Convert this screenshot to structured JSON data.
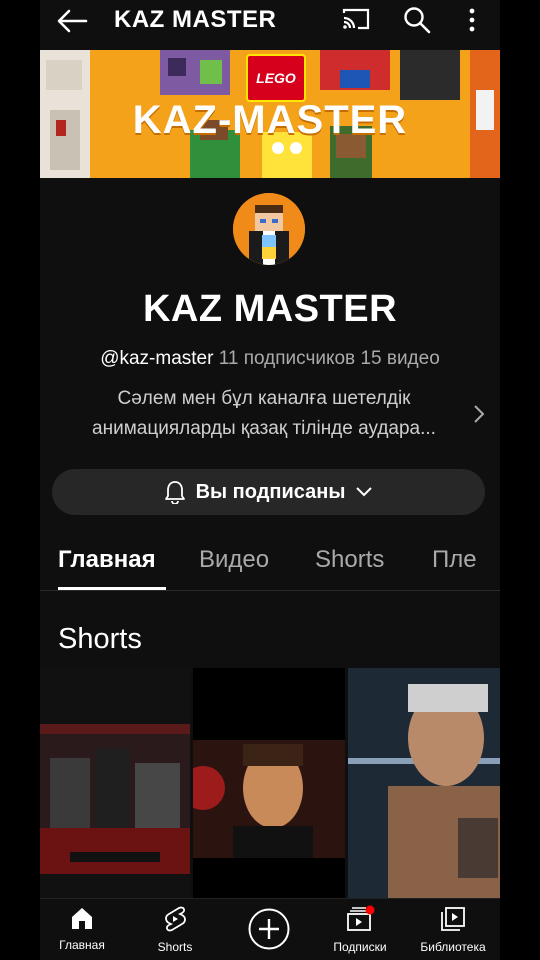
{
  "topbar": {
    "title": "KAZ MASTER",
    "icons": [
      "back-arrow-icon",
      "cast-icon",
      "search-icon",
      "more-vertical-icon"
    ]
  },
  "banner": {
    "brand": "LEGO",
    "text": "KAZ-MASTER"
  },
  "channel": {
    "name": "KAZ MASTER",
    "handle": "@kaz-master",
    "subscribers": "11 подписчиков",
    "videos": "15 видео",
    "description_line1": "Сәлем мен бұл каналға шетелдік",
    "description_line2": "анимацияларды қазақ тілінде аудара...",
    "subscribe_label": "Вы подписаны"
  },
  "tabs": [
    {
      "label": "Главная",
      "active": true
    },
    {
      "label": "Видео",
      "active": false
    },
    {
      "label": "Shorts",
      "active": false
    },
    {
      "label": "Пле",
      "active": false
    }
  ],
  "section": {
    "title": "Shorts"
  },
  "bottom_nav": [
    {
      "label": "Главная",
      "icon": "home-icon"
    },
    {
      "label": "Shorts",
      "icon": "shorts-icon"
    },
    {
      "label": "",
      "icon": "create-plus-icon"
    },
    {
      "label": "Подписки",
      "icon": "subscriptions-icon"
    },
    {
      "label": "Библиотека",
      "icon": "library-icon"
    }
  ],
  "colors": {
    "background": "#0f0f0f",
    "banner": "#f5a21b",
    "button": "#272727",
    "notification_dot": "#ff0000"
  }
}
